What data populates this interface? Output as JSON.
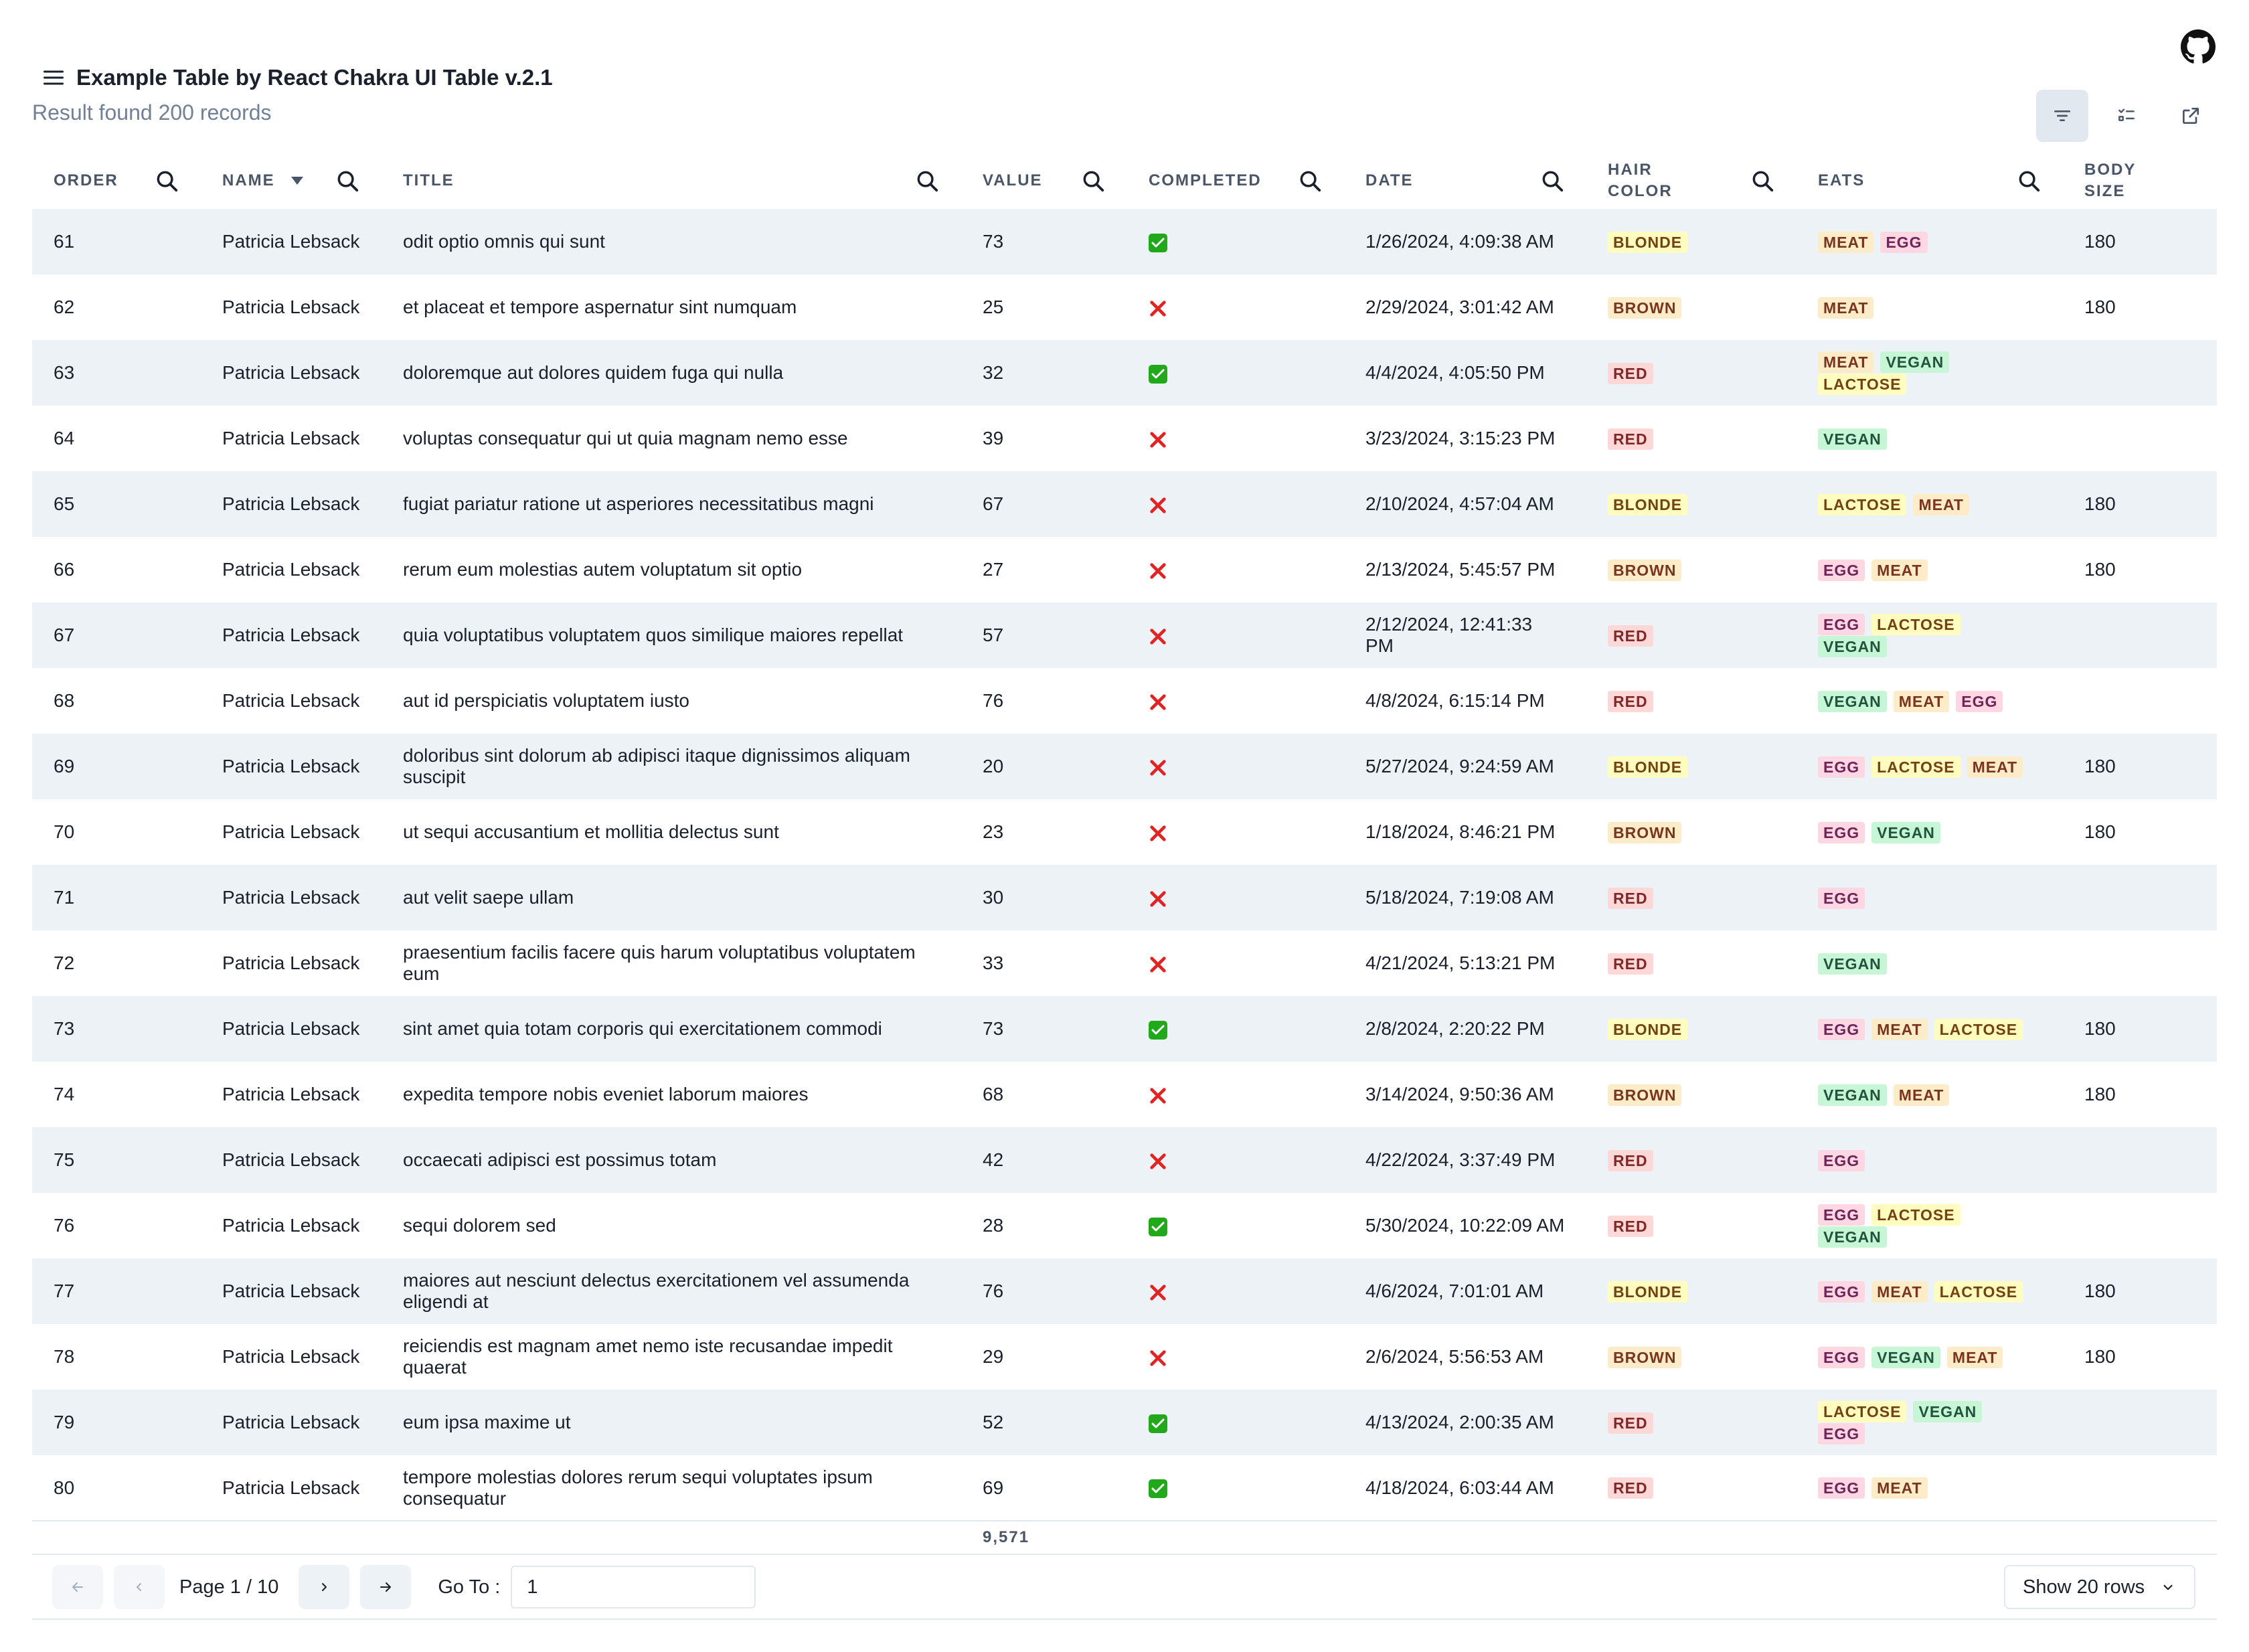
{
  "app": {
    "title": "Example Table by React Chakra UI Table v.2.1",
    "subtitle": "Result found 200 records"
  },
  "columns": [
    {
      "key": "order",
      "label": "ORDER",
      "search": true
    },
    {
      "key": "name",
      "label": "NAME",
      "search": true,
      "sorted": "desc"
    },
    {
      "key": "title",
      "label": "TITLE",
      "search": true
    },
    {
      "key": "value",
      "label": "VALUE",
      "search": true
    },
    {
      "key": "completed",
      "label": "COMPLETED",
      "search": true
    },
    {
      "key": "date",
      "label": "DATE",
      "search": true
    },
    {
      "key": "hair",
      "label": "HAIR COLOR",
      "search": true
    },
    {
      "key": "eats",
      "label": "EATS",
      "search": true
    },
    {
      "key": "body",
      "label": "BODY SIZE",
      "search": false
    }
  ],
  "rows": [
    {
      "order": "61",
      "name": "Patricia Lebsack",
      "title": "odit optio omnis qui sunt",
      "value": "73",
      "completed": true,
      "date": "1/26/2024, 4:09:38 AM",
      "hair": "BLONDE",
      "eats": [
        "MEAT",
        "EGG"
      ],
      "body": "180"
    },
    {
      "order": "62",
      "name": "Patricia Lebsack",
      "title": "et placeat et tempore aspernatur sint numquam",
      "value": "25",
      "completed": false,
      "date": "2/29/2024, 3:01:42 AM",
      "hair": "BROWN",
      "eats": [
        "MEAT"
      ],
      "body": "180"
    },
    {
      "order": "63",
      "name": "Patricia Lebsack",
      "title": "doloremque aut dolores quidem fuga qui nulla",
      "value": "32",
      "completed": true,
      "date": "4/4/2024, 4:05:50 PM",
      "hair": "RED",
      "eats": [
        "MEAT",
        "VEGAN",
        "LACTOSE"
      ],
      "body": ""
    },
    {
      "order": "64",
      "name": "Patricia Lebsack",
      "title": "voluptas consequatur qui ut quia magnam nemo esse",
      "value": "39",
      "completed": false,
      "date": "3/23/2024, 3:15:23 PM",
      "hair": "RED",
      "eats": [
        "VEGAN"
      ],
      "body": ""
    },
    {
      "order": "65",
      "name": "Patricia Lebsack",
      "title": "fugiat pariatur ratione ut asperiores necessitatibus magni",
      "value": "67",
      "completed": false,
      "date": "2/10/2024, 4:57:04 AM",
      "hair": "BLONDE",
      "eats": [
        "LACTOSE",
        "MEAT"
      ],
      "body": "180"
    },
    {
      "order": "66",
      "name": "Patricia Lebsack",
      "title": "rerum eum molestias autem voluptatum sit optio",
      "value": "27",
      "completed": false,
      "date": "2/13/2024, 5:45:57 PM",
      "hair": "BROWN",
      "eats": [
        "EGG",
        "MEAT"
      ],
      "body": "180"
    },
    {
      "order": "67",
      "name": "Patricia Lebsack",
      "title": "quia voluptatibus voluptatem quos similique maiores repellat",
      "value": "57",
      "completed": false,
      "date": "2/12/2024, 12:41:33 PM",
      "hair": "RED",
      "eats": [
        "EGG",
        "LACTOSE",
        "VEGAN"
      ],
      "body": ""
    },
    {
      "order": "68",
      "name": "Patricia Lebsack",
      "title": "aut id perspiciatis voluptatem iusto",
      "value": "76",
      "completed": false,
      "date": "4/8/2024, 6:15:14 PM",
      "hair": "RED",
      "eats": [
        "VEGAN",
        "MEAT",
        "EGG"
      ],
      "body": ""
    },
    {
      "order": "69",
      "name": "Patricia Lebsack",
      "title": "doloribus sint dolorum ab adipisci itaque dignissimos aliquam suscipit",
      "value": "20",
      "completed": false,
      "date": "5/27/2024, 9:24:59 AM",
      "hair": "BLONDE",
      "eats": [
        "EGG",
        "LACTOSE",
        "MEAT"
      ],
      "body": "180"
    },
    {
      "order": "70",
      "name": "Patricia Lebsack",
      "title": "ut sequi accusantium et mollitia delectus sunt",
      "value": "23",
      "completed": false,
      "date": "1/18/2024, 8:46:21 PM",
      "hair": "BROWN",
      "eats": [
        "EGG",
        "VEGAN"
      ],
      "body": "180"
    },
    {
      "order": "71",
      "name": "Patricia Lebsack",
      "title": "aut velit saepe ullam",
      "value": "30",
      "completed": false,
      "date": "5/18/2024, 7:19:08 AM",
      "hair": "RED",
      "eats": [
        "EGG"
      ],
      "body": ""
    },
    {
      "order": "72",
      "name": "Patricia Lebsack",
      "title": "praesentium facilis facere quis harum voluptatibus voluptatem eum",
      "value": "33",
      "completed": false,
      "date": "4/21/2024, 5:13:21 PM",
      "hair": "RED",
      "eats": [
        "VEGAN"
      ],
      "body": ""
    },
    {
      "order": "73",
      "name": "Patricia Lebsack",
      "title": "sint amet quia totam corporis qui exercitationem commodi",
      "value": "73",
      "completed": true,
      "date": "2/8/2024, 2:20:22 PM",
      "hair": "BLONDE",
      "eats": [
        "EGG",
        "MEAT",
        "LACTOSE"
      ],
      "body": "180"
    },
    {
      "order": "74",
      "name": "Patricia Lebsack",
      "title": "expedita tempore nobis eveniet laborum maiores",
      "value": "68",
      "completed": false,
      "date": "3/14/2024, 9:50:36 AM",
      "hair": "BROWN",
      "eats": [
        "VEGAN",
        "MEAT"
      ],
      "body": "180"
    },
    {
      "order": "75",
      "name": "Patricia Lebsack",
      "title": "occaecati adipisci est possimus totam",
      "value": "42",
      "completed": false,
      "date": "4/22/2024, 3:37:49 PM",
      "hair": "RED",
      "eats": [
        "EGG"
      ],
      "body": ""
    },
    {
      "order": "76",
      "name": "Patricia Lebsack",
      "title": "sequi dolorem sed",
      "value": "28",
      "completed": true,
      "date": "5/30/2024, 10:22:09 AM",
      "hair": "RED",
      "eats": [
        "EGG",
        "LACTOSE",
        "VEGAN"
      ],
      "body": ""
    },
    {
      "order": "77",
      "name": "Patricia Lebsack",
      "title": "maiores aut nesciunt delectus exercitationem vel assumenda eligendi at",
      "value": "76",
      "completed": false,
      "date": "4/6/2024, 7:01:01 AM",
      "hair": "BLONDE",
      "eats": [
        "EGG",
        "MEAT",
        "LACTOSE"
      ],
      "body": "180"
    },
    {
      "order": "78",
      "name": "Patricia Lebsack",
      "title": "reiciendis est magnam amet nemo iste recusandae impedit quaerat",
      "value": "29",
      "completed": false,
      "date": "2/6/2024, 5:56:53 AM",
      "hair": "BROWN",
      "eats": [
        "EGG",
        "VEGAN",
        "MEAT"
      ],
      "body": "180"
    },
    {
      "order": "79",
      "name": "Patricia Lebsack",
      "title": "eum ipsa maxime ut",
      "value": "52",
      "completed": true,
      "date": "4/13/2024, 2:00:35 AM",
      "hair": "RED",
      "eats": [
        "LACTOSE",
        "VEGAN",
        "EGG"
      ],
      "body": ""
    },
    {
      "order": "80",
      "name": "Patricia Lebsack",
      "title": "tempore molestias dolores rerum sequi voluptates ipsum consequatur",
      "value": "69",
      "completed": true,
      "date": "4/18/2024, 6:03:44 AM",
      "hair": "RED",
      "eats": [
        "EGG",
        "MEAT"
      ],
      "body": ""
    }
  ],
  "footer": {
    "value_total": "9,571"
  },
  "pagination": {
    "page_label": "Page 1 / 10",
    "goto_label": "Go To :",
    "goto_value": "1",
    "rows_select": "Show 20 rows"
  },
  "icons": {
    "github": "github-icon",
    "menu": "hamburger-menu-icon",
    "filter": "filter-icon",
    "columns": "column-list-icon",
    "export": "external-link-icon",
    "search": "search-icon",
    "sort": "sort-down-icon",
    "check": "check-mark-icon",
    "cross": "cross-mark-icon"
  },
  "colors": {
    "row_alt": "#edf2f7",
    "check_green": "#22a81b",
    "cross_red": "#e02424"
  }
}
